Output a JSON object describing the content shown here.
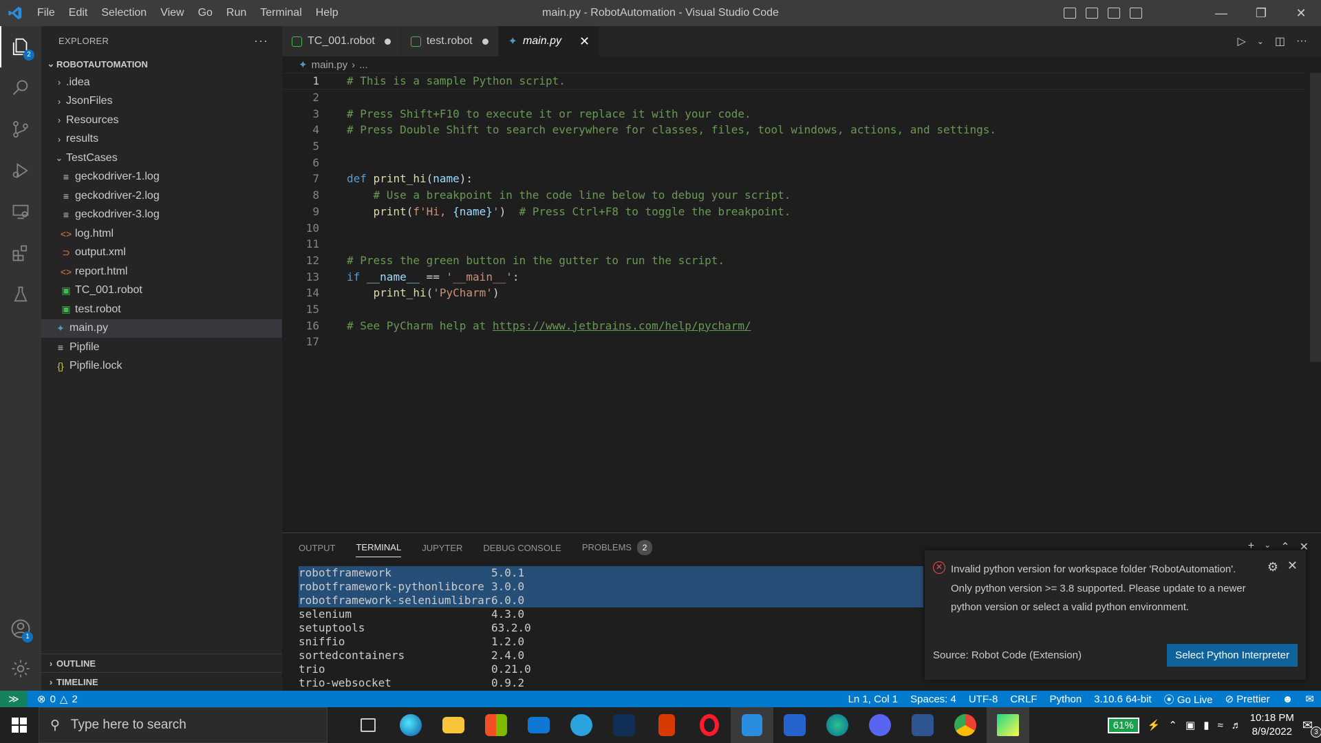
{
  "window": {
    "title": "main.py - RobotAutomation - Visual Studio Code",
    "menu": [
      "File",
      "Edit",
      "Selection",
      "View",
      "Go",
      "Run",
      "Terminal",
      "Help"
    ]
  },
  "activity": {
    "explorer_badge": "2",
    "accounts_badge": "1"
  },
  "sidebar": {
    "header": "EXPLORER",
    "root": "ROBOTAUTOMATION",
    "items": [
      {
        "label": ".idea",
        "type": "folder",
        "depth": 1
      },
      {
        "label": "JsonFiles",
        "type": "folder",
        "depth": 1
      },
      {
        "label": "Resources",
        "type": "folder",
        "depth": 1
      },
      {
        "label": "results",
        "type": "folder",
        "depth": 1
      },
      {
        "label": "TestCases",
        "type": "folder-open",
        "depth": 1
      },
      {
        "label": "geckodriver-1.log",
        "type": "log",
        "depth": 2
      },
      {
        "label": "geckodriver-2.log",
        "type": "log",
        "depth": 2
      },
      {
        "label": "geckodriver-3.log",
        "type": "log",
        "depth": 2
      },
      {
        "label": "log.html",
        "type": "html",
        "depth": 2
      },
      {
        "label": "output.xml",
        "type": "xml",
        "depth": 2
      },
      {
        "label": "report.html",
        "type": "html",
        "depth": 2
      },
      {
        "label": "TC_001.robot",
        "type": "robot",
        "depth": 2
      },
      {
        "label": "test.robot",
        "type": "robot",
        "depth": 2
      },
      {
        "label": "main.py",
        "type": "python",
        "depth": 1,
        "selected": true
      },
      {
        "label": "Pipfile",
        "type": "text",
        "depth": 1
      },
      {
        "label": "Pipfile.lock",
        "type": "json",
        "depth": 1
      }
    ],
    "outline": "OUTLINE",
    "timeline": "TIMELINE"
  },
  "tabs": [
    {
      "label": "TC_001.robot",
      "dirty": true
    },
    {
      "label": "test.robot",
      "dirty": true
    },
    {
      "label": "main.py",
      "active": true
    }
  ],
  "breadcrumb": {
    "file": "main.py",
    "rest": "..."
  },
  "code": {
    "l1": "# This is a sample Python script.",
    "l3": "# Press Shift+F10 to execute it or replace it with your code.",
    "l4": "# Press Double Shift to search everywhere for classes, files, tool windows, actions, and settings.",
    "l7_kw": "def",
    "l7_fn": "print_hi",
    "l7_p": "name",
    "l8": "# Use a breakpoint in the code line below to debug your script.",
    "l9_fn": "print",
    "l9_str1": "f'Hi, ",
    "l9_var": "{name}",
    "l9_str2": "'",
    "l9_cm": "# Press Ctrl+F8 to toggle the breakpoint.",
    "l12": "# Press the green button in the gutter to run the script.",
    "l13_kw": "if",
    "l13_var": "__name__",
    "l13_op": "==",
    "l13_str": "'__main__'",
    "l14_fn": "print_hi",
    "l14_str": "'PyCharm'",
    "l16_cm": "# See PyCharm help at ",
    "l16_url": "https://www.jetbrains.com/help/pycharm/"
  },
  "panel": {
    "tabs": [
      "OUTPUT",
      "TERMINAL",
      "JUPYTER",
      "DEBUG CONSOLE",
      "PROBLEMS"
    ],
    "active_tab": "TERMINAL",
    "problems_count": "2",
    "terminal_rows": [
      {
        "name": "robotframework",
        "version": "5.0.1",
        "selected": true
      },
      {
        "name": "robotframework-pythonlibcore",
        "version": "3.0.0",
        "selected": true
      },
      {
        "name": "robotframework-seleniumlibrary",
        "version": "6.0.0",
        "selected": true
      },
      {
        "name": "selenium",
        "version": "4.3.0"
      },
      {
        "name": "setuptools",
        "version": "63.2.0"
      },
      {
        "name": "sniffio",
        "version": "1.2.0"
      },
      {
        "name": "sortedcontainers",
        "version": "2.4.0"
      },
      {
        "name": "trio",
        "version": "0.21.0"
      },
      {
        "name": "trio-websocket",
        "version": "0.9.2"
      }
    ]
  },
  "notification": {
    "message": "Invalid python version for workspace folder 'RobotAutomation'. Only python version >= 3.8 supported. Please update to a newer python version or select a valid python environment.",
    "source": "Source: Robot Code (Extension)",
    "button": "Select Python Interpreter"
  },
  "status": {
    "errors": "0",
    "warnings": "2",
    "position": "Ln 1, Col 1",
    "spaces": "Spaces: 4",
    "encoding": "UTF-8",
    "eol": "CRLF",
    "language": "Python",
    "interpreter": "3.10.6 64-bit",
    "golive": "Go Live",
    "prettier": "Prettier"
  },
  "taskbar": {
    "search_placeholder": "Type here to search",
    "battery": "61%",
    "time": "10:18 PM",
    "date": "8/9/2022",
    "notif_count": "3"
  },
  "colors": {
    "accent": "#007acc",
    "error": "#f14c4c",
    "button": "#0e639c"
  }
}
